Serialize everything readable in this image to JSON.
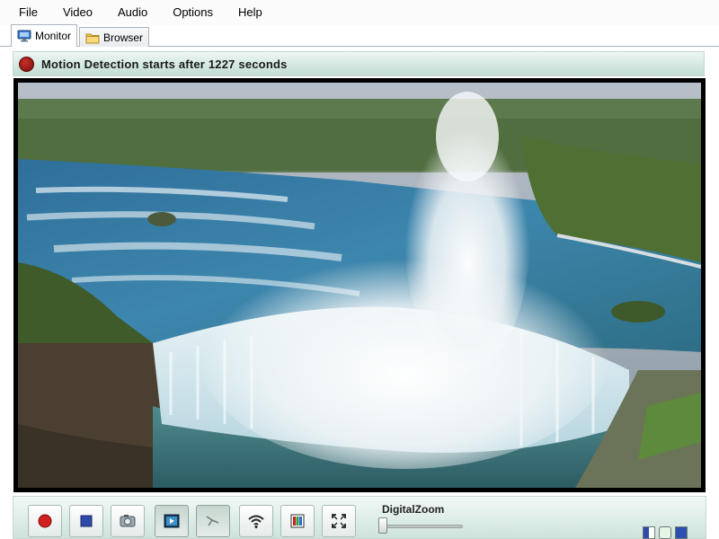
{
  "menu": [
    "File",
    "Video",
    "Audio",
    "Options",
    "Help"
  ],
  "tabs": [
    {
      "label": "Monitor",
      "icon": "monitor-icon",
      "active": true
    },
    {
      "label": "Browser",
      "icon": "folder-icon",
      "active": false
    }
  ],
  "status": {
    "text": "Motion Detection starts after 1227 seconds",
    "indicator_color": "#8b1410"
  },
  "video": {
    "scene": "waterfall-aerial-icon"
  },
  "toolbar": {
    "buttons": [
      {
        "icon": "record-icon"
      },
      {
        "icon": "stop-icon"
      },
      {
        "icon": "snapshot-icon"
      },
      {
        "icon": "video-toggle-icon",
        "pressed": true
      },
      {
        "icon": "pan-tilt-icon",
        "pressed": true
      },
      {
        "icon": "wifi-icon"
      },
      {
        "icon": "film-icon"
      },
      {
        "icon": "fullscreen-icon"
      }
    ],
    "zoom_label": "DigitalZoom",
    "zoom_level": 0
  },
  "colors": {
    "accent_green": "#cde3db",
    "record_red": "#d12020",
    "border": "#a9b3bd"
  }
}
